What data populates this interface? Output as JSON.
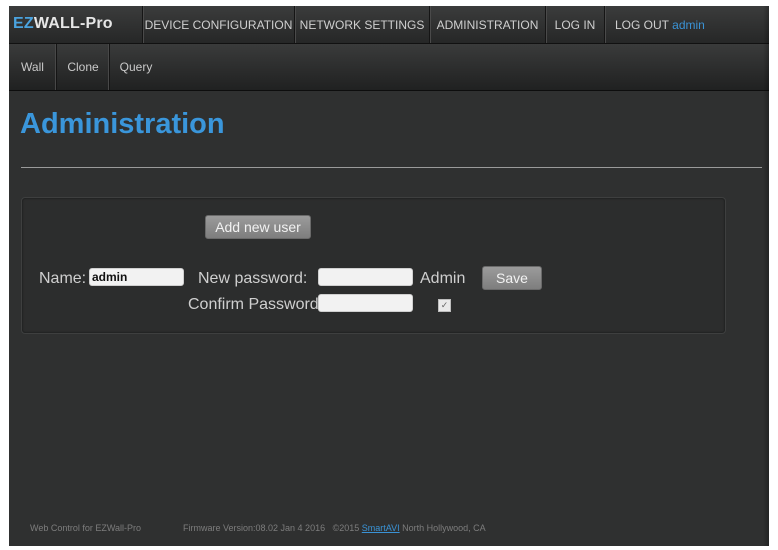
{
  "header": {
    "logo_ez": "EZ",
    "logo_rest": "WALL-Pro",
    "nav": {
      "device_configuration": "DEVICE CONFIGURATION",
      "network_settings": "NETWORK SETTINGS",
      "administration": "ADMINISTRATION",
      "log_in": "LOG IN",
      "log_out": "LOG OUT",
      "current_user": "admin"
    }
  },
  "subnav": {
    "wall": "Wall",
    "clone": "Clone",
    "query": "Query"
  },
  "page": {
    "title": "Administration"
  },
  "form": {
    "add_user_label": "Add new user",
    "name_label": "Name:",
    "name_value": "admin",
    "new_password_label": "New password:",
    "new_password_value": "",
    "confirm_password_label": "Confirm Password",
    "confirm_password_value": "",
    "admin_label": "Admin",
    "admin_checked": true,
    "save_label": "Save"
  },
  "footer": {
    "web_control": "Web Control for EZWall-Pro",
    "firmware": "Firmware Version:08.02 Jan 4 2016",
    "copyright": "©2015",
    "company": "SmartAVI",
    "location": "North Hollywood, CA"
  },
  "colors": {
    "accent": "#3a96db",
    "background": "#2f3030",
    "nav_background": "#2a2b2b",
    "button": "#8c8c8c"
  }
}
